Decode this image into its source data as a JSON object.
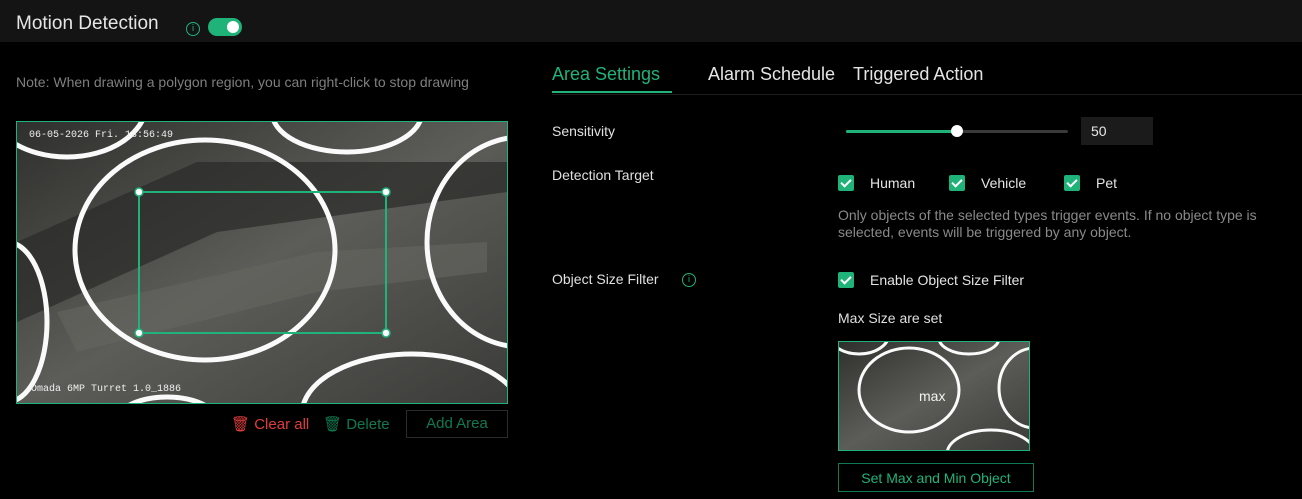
{
  "header": {
    "title": "Motion Detection",
    "enabled": true
  },
  "note": "Note: When drawing a polygon region, you can right-click to stop drawing",
  "preview": {
    "timestamp": "06-05-2026 Fri. 18:56:49",
    "camera_name": "Omada 6MP Turret 1.0_1886"
  },
  "tools": {
    "clear_all": "Clear all",
    "delete": "Delete",
    "add_area": "Add Area"
  },
  "tabs": [
    {
      "label": "Area Settings",
      "active": true
    },
    {
      "label": "Alarm Schedule",
      "active": false
    },
    {
      "label": "Triggered Action",
      "active": false
    }
  ],
  "sensitivity": {
    "label": "Sensitivity",
    "value": "50",
    "fraction": 0.5
  },
  "detection_target": {
    "label": "Detection Target",
    "options": [
      {
        "label": "Human",
        "checked": true
      },
      {
        "label": "Vehicle",
        "checked": true
      },
      {
        "label": "Pet",
        "checked": true
      }
    ],
    "hint": "Only objects of the selected types trigger events. If no object type is selected, events will be triggered by any object."
  },
  "object_size_filter": {
    "label": "Object Size Filter",
    "checkbox_label": "Enable Object Size Filter",
    "checked": true,
    "max_size_label": "Max Size are set",
    "thumb_label": "max",
    "button": "Set Max and Min Object"
  },
  "colors": {
    "accent": "#1fb37a",
    "danger": "#e03c3c",
    "background": "#000000"
  }
}
